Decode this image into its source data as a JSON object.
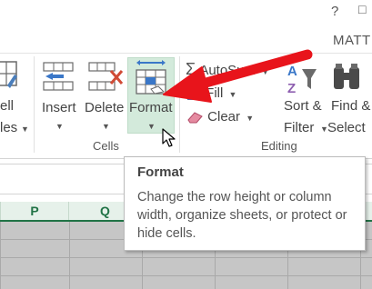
{
  "titlebar": {
    "help": "?",
    "ribbon_toggle": "□",
    "user": "MATT"
  },
  "ribbon": {
    "cells_group": {
      "cell_styles": {
        "line1": "ell",
        "line2": "les"
      },
      "insert": {
        "label": "Insert"
      },
      "delete": {
        "label": "Delete"
      },
      "format": {
        "label": "Format"
      },
      "group_label": "Cells"
    },
    "editing_group": {
      "autosum": {
        "label": "AutoSum"
      },
      "fill": {
        "label": "Fill"
      },
      "clear": {
        "label": "Clear"
      },
      "sort_filter": {
        "line1": "Sort &",
        "line2": "Filter"
      },
      "find_select": {
        "line1": "Find &",
        "line2": "Select"
      },
      "group_label": "Editing"
    }
  },
  "columns": [
    "P",
    "Q"
  ],
  "tooltip": {
    "title": "Format",
    "body": "Change the row height or column width, organize sheets, or protect or hide cells."
  },
  "colors": {
    "accent_green": "#217346",
    "highlight": "#d3eadb",
    "arrow_red": "#e8141b"
  }
}
